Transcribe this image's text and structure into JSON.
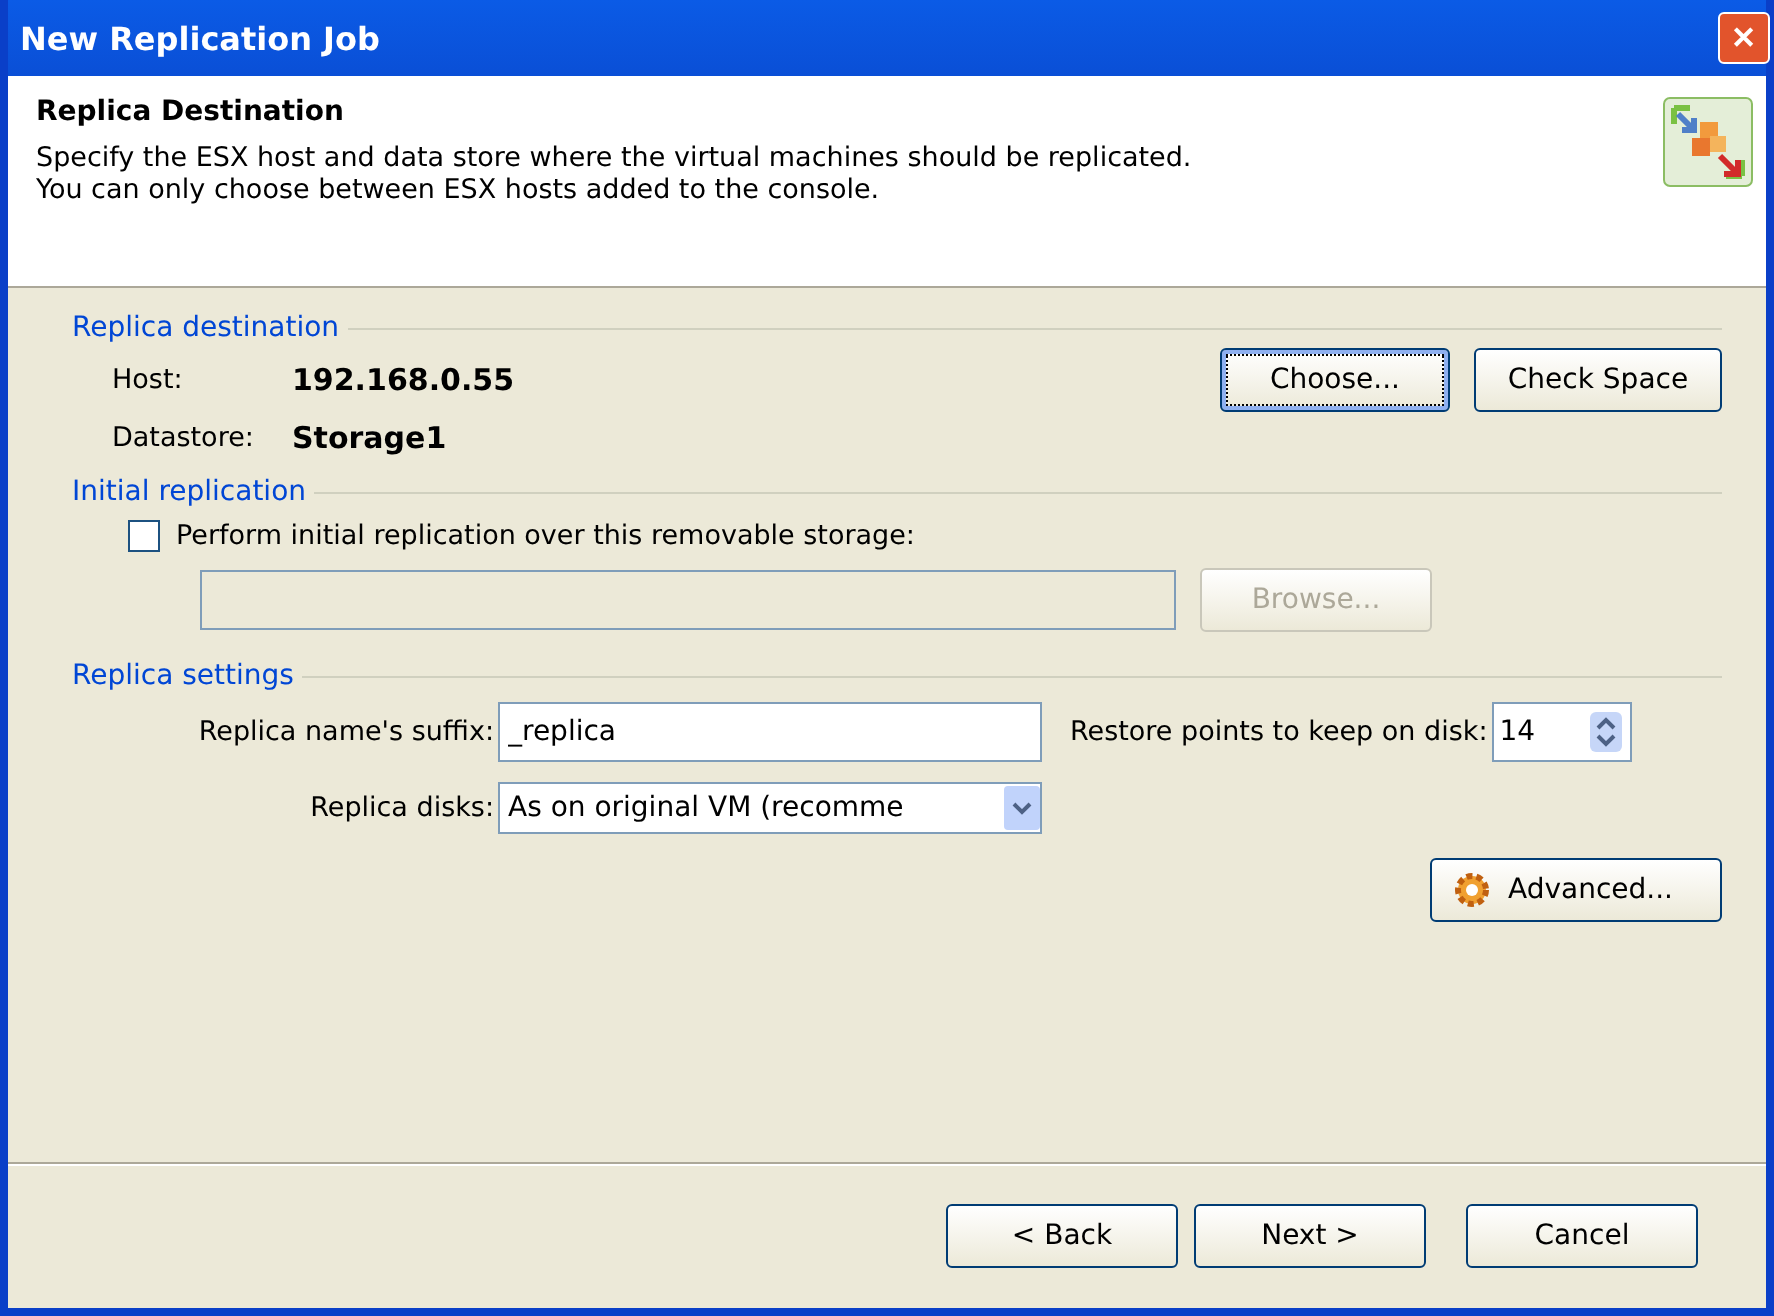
{
  "window": {
    "title": "New Replication Job",
    "close": "✕"
  },
  "header": {
    "title": "Replica Destination",
    "description": "Specify the ESX host and data store where the virtual machines should be replicated.\nYou can only choose between ESX hosts added to the console."
  },
  "destination": {
    "legend": "Replica destination",
    "host_label": "Host:",
    "host": "192.168.0.55",
    "datastore_label": "Datastore:",
    "datastore": "Storage1",
    "buttons": [
      {
        "label": "Choose...",
        "focused": true
      },
      {
        "label": "Check Space",
        "focused": false
      }
    ]
  },
  "initial": {
    "legend": "Initial replication",
    "checkbox": {
      "label": "Perform initial replication over this removable storage:",
      "checked": false
    },
    "path": {
      "disabled": true
    },
    "browse": {
      "label": "Browse...",
      "disabled": true
    }
  },
  "settings": {
    "legend": "Replica settings",
    "suffix_label": "Replica name's suffix:",
    "suffix": "_replica",
    "restore_label": "Restore points to keep on disk:",
    "restore": "14",
    "disks_label": "Replica disks:",
    "disks": "As on original VM (recomme",
    "advanced": "Advanced..."
  },
  "footer": {
    "buttons": [
      {
        "label": "< Back",
        "disabled": false
      },
      {
        "label": "Next >",
        "disabled": false
      },
      {
        "label": "Cancel",
        "disabled": false
      }
    ]
  }
}
